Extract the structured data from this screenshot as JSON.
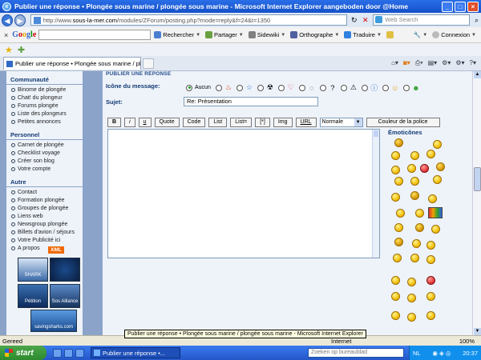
{
  "window": {
    "title": "Publier une réponse • Plongée sous marine / plongée sous marine - Microsoft Internet Explorer aangeboden door @Home"
  },
  "address": {
    "prefix": "http://www.",
    "domain": "sous-la-mer.com",
    "path": "/modules/ZForum/posting.php?mode=reply&f=24&t=1350",
    "web_search_placeholder": "Web Search"
  },
  "google": {
    "rechercher": "Rechercher",
    "partager": "Partager",
    "sidewiki": "Sidewiki",
    "orthographe": "Orthographe",
    "traduire": "Traduire",
    "connexion": "Connexion"
  },
  "tab": {
    "label": "Publier une réponse • Plongée sous marine / plongée ..."
  },
  "sidebar": {
    "sections": [
      {
        "head": "Communauté",
        "items": [
          "Binome de plongée",
          "Chat! du plongeur",
          "Forums plongée",
          "Liste des plongeurs",
          "Petites annonces"
        ]
      },
      {
        "head": "Personnel",
        "items": [
          "Carnet de plongée",
          "Checklist voyage",
          "Créer son blog",
          "Votre compte"
        ]
      },
      {
        "head": "Autre",
        "items": [
          "Contact",
          "Formation plongée",
          "Groupes de plongée",
          "Liens web",
          "Newsgroup plongée",
          "Billets d'avion / séjours",
          "Votre Publicité ici",
          "A propos"
        ]
      }
    ],
    "xml_badge": "XML",
    "banners": [
      "SHARK",
      "",
      "Pétition",
      "Sos Alliance",
      "savingsharks.com"
    ]
  },
  "form": {
    "section_title": "PUBLIER UNE RÉPONSE",
    "icon_label": "Icône du message:",
    "no_icon": "Aucun",
    "subject_label": "Sujet:",
    "subject_value": "Re: Présentation",
    "buttons": [
      "B",
      "i",
      "u",
      "Quote",
      "Code",
      "List",
      "List=",
      "[*]",
      "Img",
      "URL"
    ],
    "size_select": "Normale",
    "color_button": "Couleur de la police",
    "emoticons_title": "Émoticônes"
  },
  "status": {
    "text": "Gereed",
    "tooltip": "Publier une réponse • Plongée sous marine / plongée sous marine - Microsoft Internet Explorer",
    "zoom": "100%"
  },
  "taskbar": {
    "start": "start",
    "item": "Publier une réponse •...",
    "search_placeholder": "Zoeken op bureaublad",
    "lang": "NL",
    "clock": "20:37"
  }
}
